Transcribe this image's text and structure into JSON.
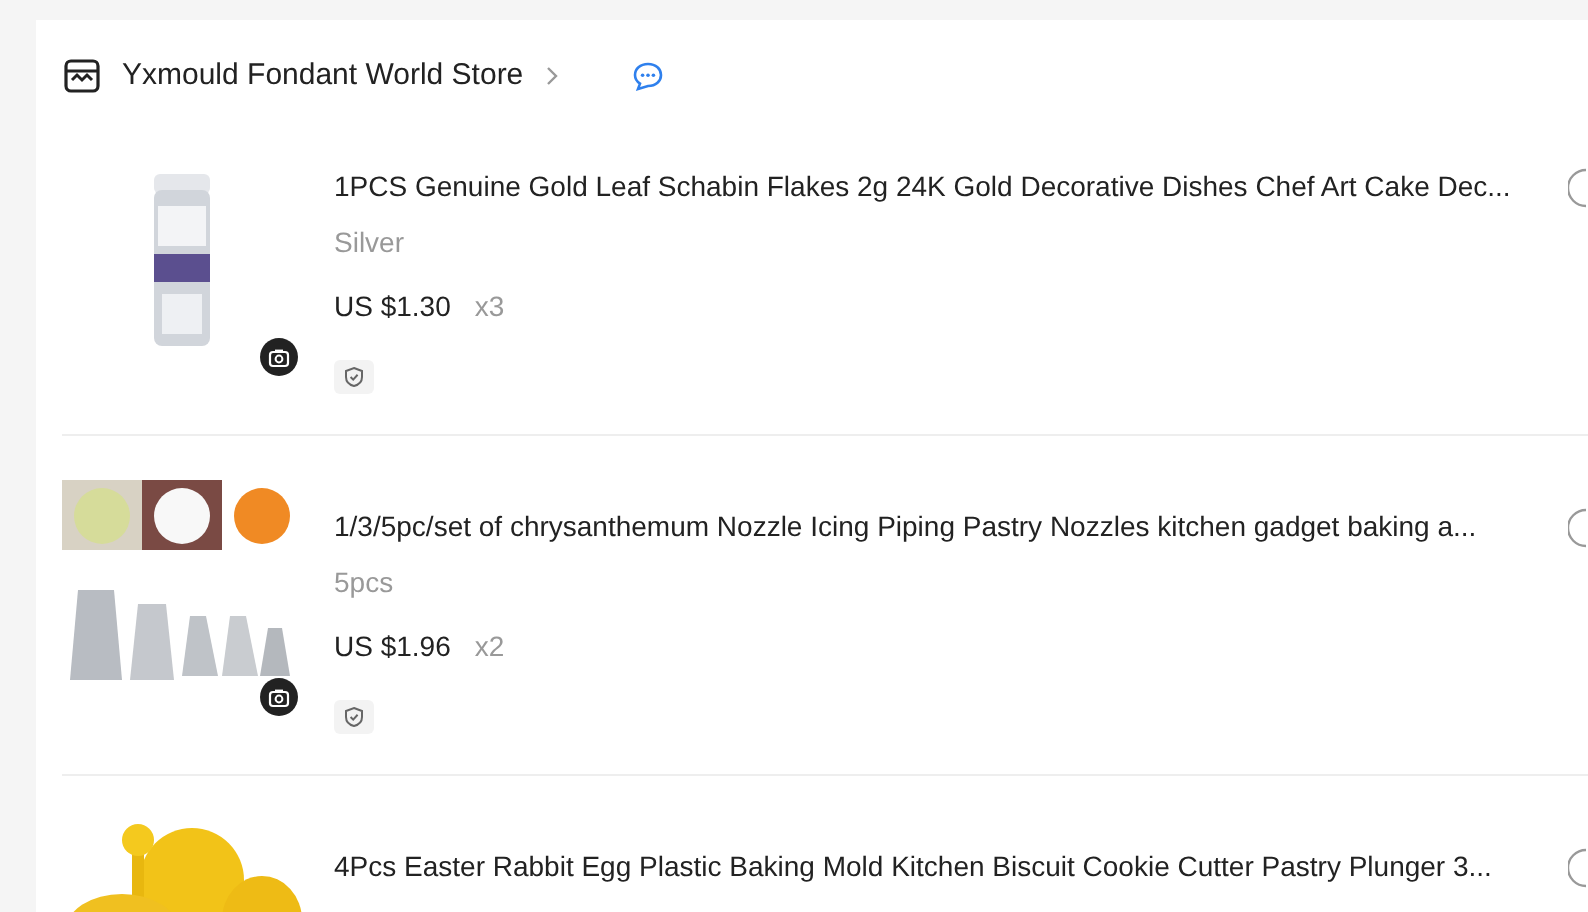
{
  "store": {
    "name": "Yxmould Fondant World Store"
  },
  "items": [
    {
      "kind": "bottle",
      "title": "1PCS Genuine Gold Leaf Schabin Flakes 2g 24K Gold Decorative Dishes Chef Art Cake Dec...",
      "variant": "Silver",
      "price": "US $1.30",
      "quantity": "x3"
    },
    {
      "kind": "nozzles",
      "title": "1/3/5pc/set of chrysanthemum Nozzle Icing Piping Pastry Nozzles kitchen gadget baking a...",
      "variant": "5pcs",
      "price": "US $1.96",
      "quantity": "x2"
    },
    {
      "kind": "mold",
      "title": "4Pcs Easter Rabbit Egg Plastic Baking Mold Kitchen Biscuit Cookie Cutter Pastry Plunger 3..."
    }
  ]
}
